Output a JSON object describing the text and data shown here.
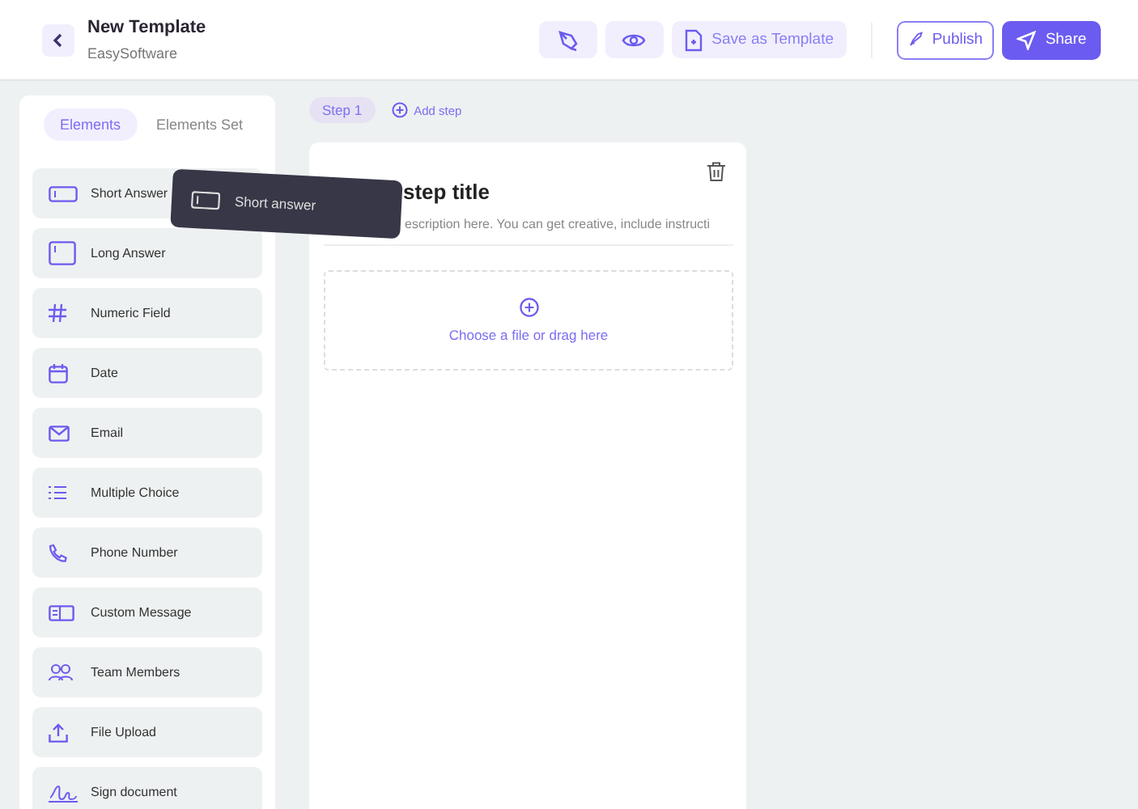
{
  "header": {
    "title": "New Template",
    "subtitle": "EasySoftware",
    "actions": [
      {
        "kind": "pen"
      },
      {
        "kind": "eye"
      },
      {
        "kind": "file",
        "label": "Save as Template"
      }
    ],
    "publish": "Publish",
    "share": "Share"
  },
  "sidebar": {
    "tabs": [
      {
        "label": "Elements",
        "selected": true
      },
      {
        "label": "Elements Set",
        "selected": false
      }
    ],
    "items": [
      {
        "kind": "short",
        "label": "Short Answer"
      },
      {
        "kind": "long",
        "label": "Long Answer"
      },
      {
        "kind": "hash",
        "label": "Numeric Field"
      },
      {
        "kind": "date",
        "label": "Date"
      },
      {
        "kind": "mail",
        "label": "Email"
      },
      {
        "kind": "list",
        "label": "Multiple Choice"
      },
      {
        "kind": "phone",
        "label": "Phone Number"
      },
      {
        "kind": "msg",
        "label": "Custom Message"
      },
      {
        "kind": "team",
        "label": "Team Members"
      },
      {
        "kind": "upload",
        "label": "File Upload"
      },
      {
        "kind": "sign",
        "label": "Sign document"
      }
    ]
  },
  "steps": [
    {
      "label": "Step 1",
      "selected": true
    }
  ],
  "add_step": "Add step",
  "step_card": {
    "title": "step title",
    "description": "escription here. You can get creative, include instructi",
    "dropzone": "Choose a file or drag here"
  },
  "drag_ghost": {
    "label": "Short answer"
  }
}
